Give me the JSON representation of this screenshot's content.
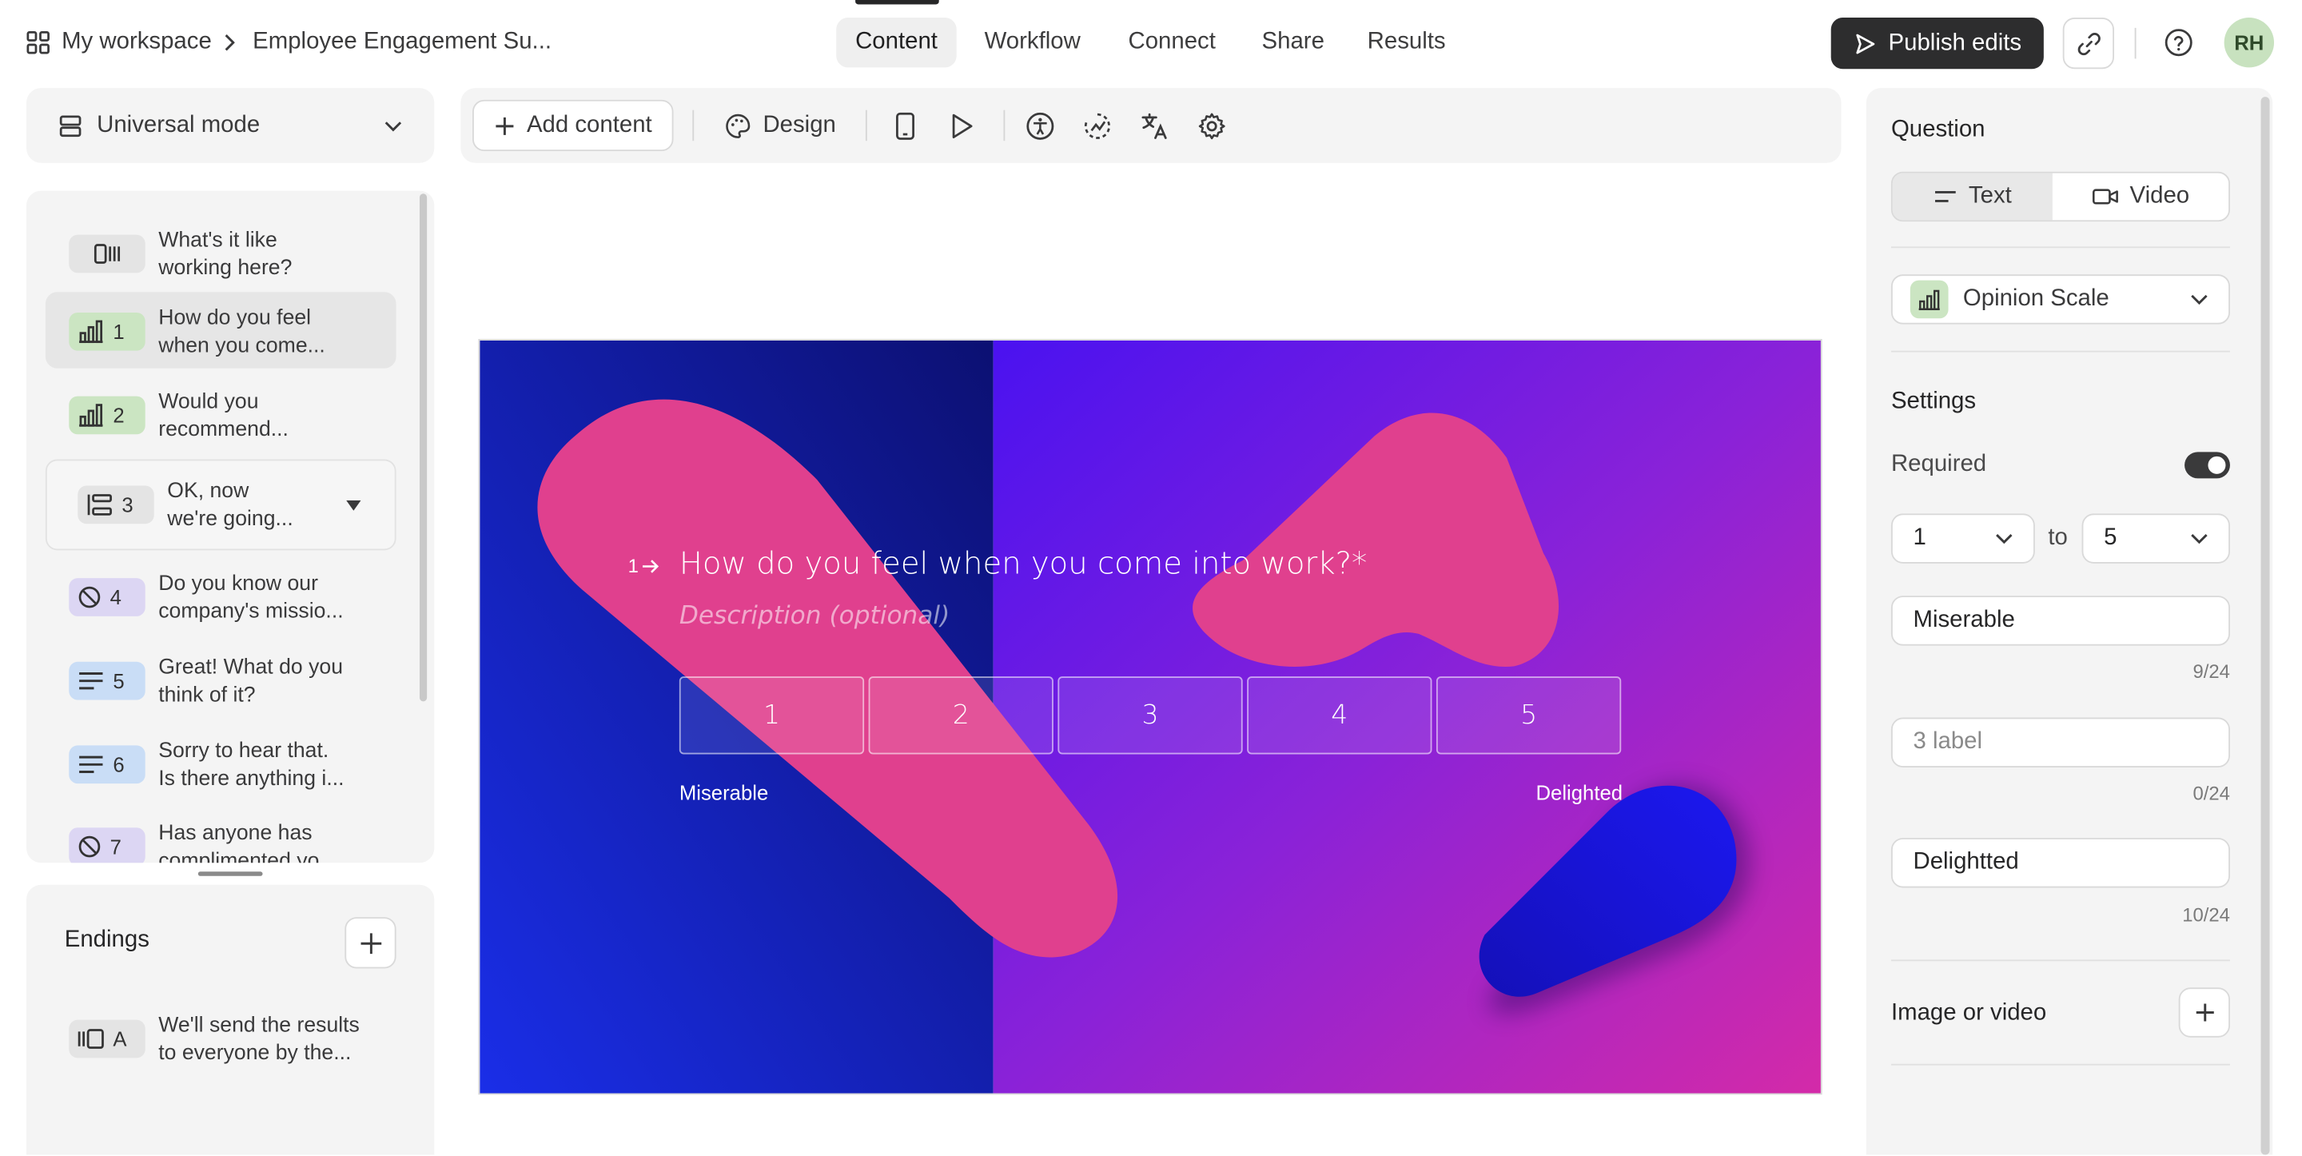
{
  "breadcrumb": {
    "workspace": "My workspace",
    "form": "Employee Engagement Su..."
  },
  "nav": {
    "tabs": [
      "Content",
      "Workflow",
      "Connect",
      "Share",
      "Results"
    ]
  },
  "header": {
    "publish_label": "Publish edits",
    "avatar_initials": "RH"
  },
  "left": {
    "mode_label": "Universal mode",
    "questions": [
      {
        "num": "",
        "line1": "What's it like",
        "line2": "working here?"
      },
      {
        "num": "1",
        "line1": "How do you feel",
        "line2": "when you come..."
      },
      {
        "num": "2",
        "line1": "Would you",
        "line2": "recommend..."
      },
      {
        "num": "3",
        "line1": "OK, now",
        "line2": "we're going..."
      },
      {
        "num": "4",
        "line1": "Do you know our",
        "line2": "company's missio..."
      },
      {
        "num": "5",
        "line1": "Great! What do you",
        "line2": "think of it?"
      },
      {
        "num": "6",
        "line1": "Sorry to hear that.",
        "line2": "Is there anything i..."
      },
      {
        "num": "7",
        "line1": "Has anyone has",
        "line2": "complimented yo..."
      }
    ],
    "endings_title": "Endings",
    "ending": {
      "num": "A",
      "line1": "We'll send the results",
      "line2": "to everyone by the..."
    }
  },
  "toolbar": {
    "add_content": "Add content",
    "design": "Design"
  },
  "canvas": {
    "question_number": "1",
    "question": "How do you feel when you come into work?*",
    "description_placeholder": "Description (optional)",
    "choices": [
      "1",
      "2",
      "3",
      "4",
      "5"
    ],
    "left_label": "Miserable",
    "right_label": "Delighted"
  },
  "right": {
    "question_title": "Question",
    "text_option": "Text",
    "video_option": "Video",
    "question_type": "Opinion Scale",
    "settings_title": "Settings",
    "required_label": "Required",
    "required_on": true,
    "scale_from": "1",
    "to_label": "to",
    "scale_to": "5",
    "label_left_value": "Miserable",
    "label_left_count": "9/24",
    "label_mid_placeholder": "3 label",
    "label_mid_count": "0/24",
    "label_right_value": "Delightted",
    "label_right_count": "10/24",
    "image_video_title": "Image or video"
  },
  "colors": {
    "badge_scale": "#cbe5c2",
    "badge_statement": "#e4e4e4",
    "badge_boolean": "#dcd6f3",
    "badge_text": "#c9ddf6",
    "pink_shape": "#e0408e",
    "primary_dark": "#2d2d2e"
  }
}
